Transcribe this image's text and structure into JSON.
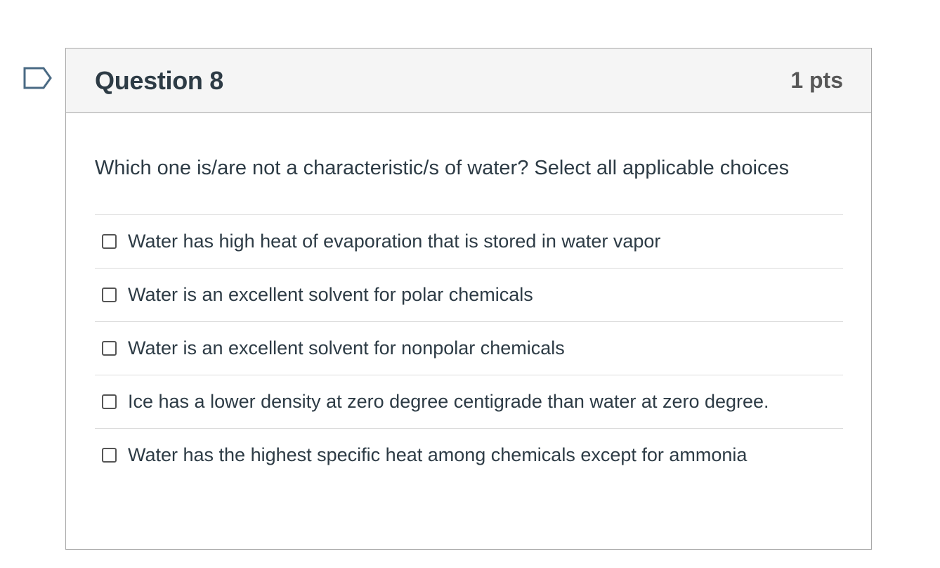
{
  "question": {
    "title": "Question 8",
    "points": "1 pts",
    "text": "Which one is/are not a characteristic/s of water? Select all applicable choices",
    "flag_icon": "bookmark-flag-icon",
    "answers": [
      {
        "label": "Water has high heat of evaporation that is stored in water vapor",
        "checked": false
      },
      {
        "label": "Water is an excellent solvent for polar chemicals",
        "checked": false
      },
      {
        "label": "Water is an excellent solvent for nonpolar chemicals",
        "checked": false
      },
      {
        "label": "Ice has a lower density at zero degree centigrade than water at zero degree.",
        "checked": false
      },
      {
        "label": "Water has the highest specific heat among chemicals except for ammonia",
        "checked": false
      }
    ]
  },
  "colors": {
    "text": "#2d3b45",
    "header_bg": "#f5f5f5",
    "border": "#a8a8a8",
    "flag_stroke": "#4a6a84"
  }
}
